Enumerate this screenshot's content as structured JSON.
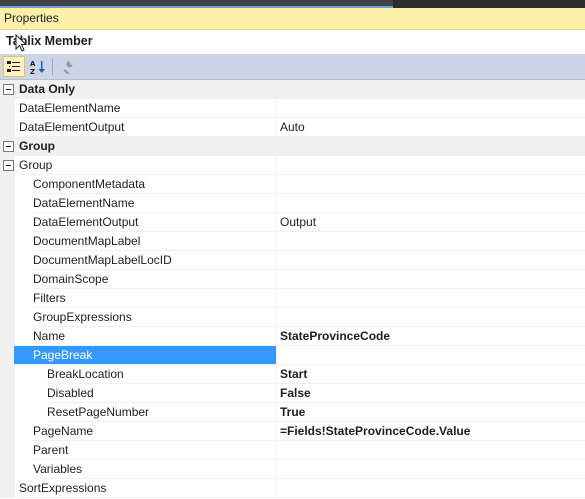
{
  "panel": {
    "title": "Properties"
  },
  "object": {
    "name": "Tablix Member"
  },
  "toolbar": {
    "buttons": [
      {
        "icon": "categorized-icon",
        "active": true
      },
      {
        "icon": "alphabetical-sort-icon",
        "active": false
      },
      {
        "icon": "property-pages-wrench-icon",
        "active": false
      }
    ]
  },
  "grid": {
    "rows": [
      {
        "kind": "category",
        "name": "Data Only",
        "value": ""
      },
      {
        "kind": "prop",
        "level": 0,
        "name": "DataElementName",
        "value": ""
      },
      {
        "kind": "prop",
        "level": 0,
        "name": "DataElementOutput",
        "value": "Auto"
      },
      {
        "kind": "category",
        "name": "Group",
        "value": ""
      },
      {
        "kind": "group",
        "level": 0,
        "name": "Group",
        "value": ""
      },
      {
        "kind": "prop",
        "level": 1,
        "name": "ComponentMetadata",
        "value": ""
      },
      {
        "kind": "prop",
        "level": 1,
        "name": "DataElementName",
        "value": ""
      },
      {
        "kind": "prop",
        "level": 1,
        "name": "DataElementOutput",
        "value": "Output"
      },
      {
        "kind": "prop",
        "level": 1,
        "name": "DocumentMapLabel",
        "value": ""
      },
      {
        "kind": "prop",
        "level": 1,
        "name": "DocumentMapLabelLocID",
        "value": ""
      },
      {
        "kind": "prop",
        "level": 1,
        "name": "DomainScope",
        "value": ""
      },
      {
        "kind": "prop",
        "level": 1,
        "name": "Filters",
        "value": ""
      },
      {
        "kind": "prop",
        "level": 1,
        "name": "GroupExpressions",
        "value": ""
      },
      {
        "kind": "prop",
        "level": 1,
        "name": "Name",
        "value": "StateProvinceCode",
        "bold": true
      },
      {
        "kind": "group",
        "level": 1,
        "name": "PageBreak",
        "value": "",
        "selected": true
      },
      {
        "kind": "prop",
        "level": 2,
        "name": "BreakLocation",
        "value": "Start",
        "bold": true
      },
      {
        "kind": "prop",
        "level": 2,
        "name": "Disabled",
        "value": "False",
        "bold": true
      },
      {
        "kind": "prop",
        "level": 2,
        "name": "ResetPageNumber",
        "value": "True",
        "bold": true
      },
      {
        "kind": "prop",
        "level": 1,
        "name": "PageName",
        "value": "=Fields!StateProvinceCode.Value",
        "bold": true
      },
      {
        "kind": "prop",
        "level": 1,
        "name": "Parent",
        "value": ""
      },
      {
        "kind": "prop",
        "level": 1,
        "name": "Variables",
        "value": ""
      },
      {
        "kind": "prop",
        "level": 0,
        "name": "SortExpressions",
        "value": ""
      }
    ]
  },
  "colors": {
    "title_bar": "#fcf0a8",
    "toolbar": "#ccd5e6",
    "selection": "#3399ff",
    "category_bg": "#f0f0f0"
  }
}
